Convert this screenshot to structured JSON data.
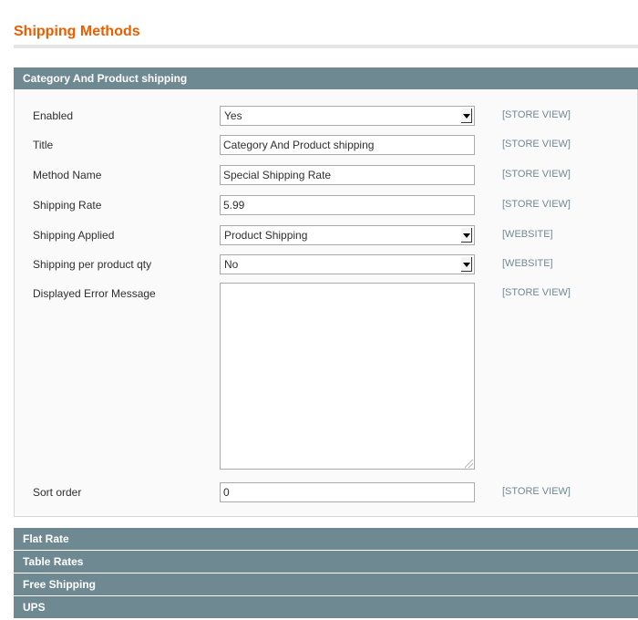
{
  "page_title": "Shipping Methods",
  "sections": {
    "main": {
      "label": "Category And Product shipping"
    },
    "collapsed": [
      {
        "label": "Flat Rate"
      },
      {
        "label": "Table Rates"
      },
      {
        "label": "Free Shipping"
      },
      {
        "label": "UPS"
      }
    ]
  },
  "form": {
    "enabled": {
      "label": "Enabled",
      "value": "Yes",
      "scope": "[STORE VIEW]"
    },
    "title": {
      "label": "Title",
      "value": "Category And Product shipping",
      "scope": "[STORE VIEW]"
    },
    "method_name": {
      "label": "Method Name",
      "value": "Special Shipping Rate",
      "scope": "[STORE VIEW]"
    },
    "shipping_rate": {
      "label": "Shipping Rate",
      "value": "5.99",
      "scope": "[STORE VIEW]"
    },
    "shipping_applied": {
      "label": "Shipping Applied",
      "value": "Product Shipping",
      "scope": "[WEBSITE]"
    },
    "shipping_per_qty": {
      "label": "Shipping per product qty",
      "value": "No",
      "scope": "[WEBSITE]"
    },
    "error_message": {
      "label": "Displayed Error Message",
      "value": "",
      "scope": "[STORE VIEW]"
    },
    "sort_order": {
      "label": "Sort order",
      "value": "0",
      "scope": "[STORE VIEW]"
    }
  },
  "colors": {
    "title": "#eb5e00",
    "section_header": "#6f8992",
    "scope_text": "#6f8992"
  },
  "icons": {
    "select_arrow": "chevron-down-icon",
    "resize": "resize-grip-icon"
  }
}
